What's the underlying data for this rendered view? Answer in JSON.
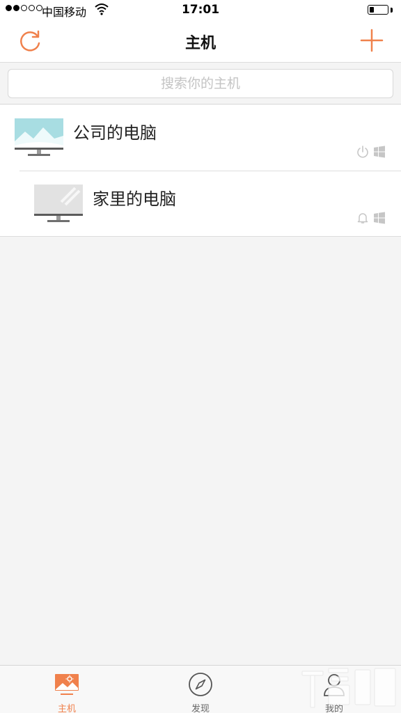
{
  "status_bar": {
    "carrier": "中国移动",
    "time": "17:01"
  },
  "nav": {
    "title": "主机",
    "refresh_icon": "refresh-icon",
    "add_icon": "plus-icon"
  },
  "search": {
    "placeholder": "搜索你的主机",
    "value": ""
  },
  "hosts": [
    {
      "name": "公司的电脑",
      "icon": "monitor-landscape-icon",
      "status_icons": [
        "power-icon",
        "windows-icon"
      ]
    },
    {
      "name": "家里的电脑",
      "icon": "monitor-offline-icon",
      "status_icons": [
        "bell-icon",
        "windows-icon"
      ]
    }
  ],
  "tabs": [
    {
      "label": "主机",
      "icon": "host-icon",
      "active": true
    },
    {
      "label": "发现",
      "icon": "compass-icon",
      "active": false
    },
    {
      "label": "我的",
      "icon": "user-icon",
      "active": false
    }
  ],
  "colors": {
    "accent": "#f0814c",
    "inactive": "#666666",
    "background": "#f4f4f4"
  }
}
